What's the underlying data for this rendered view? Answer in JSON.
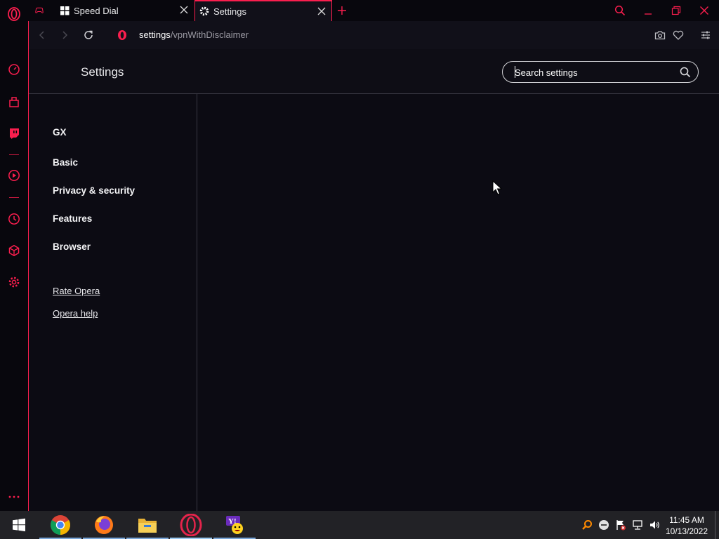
{
  "tabs": [
    {
      "title": "Speed Dial",
      "active": false
    },
    {
      "title": "Settings",
      "active": true
    }
  ],
  "address": {
    "host": "settings",
    "path": "/vpnWithDisclaimer"
  },
  "settings": {
    "title": "Settings",
    "search_placeholder": "Search settings",
    "nav_items": [
      "GX",
      "Basic",
      "Privacy & security",
      "Features",
      "Browser"
    ],
    "links": [
      "Rate Opera",
      "Opera help"
    ]
  },
  "taskbar": {
    "apps": [
      "start-button",
      "chrome",
      "firefox",
      "file-explorer",
      "opera-gx",
      "yahoo-messenger"
    ],
    "time": "11:45 AM",
    "date": "10/13/2022"
  },
  "colors": {
    "accent": "#fa1e4e",
    "background": "#0c0b13",
    "sidebar": "#08070d",
    "taskbar": "#222226"
  }
}
